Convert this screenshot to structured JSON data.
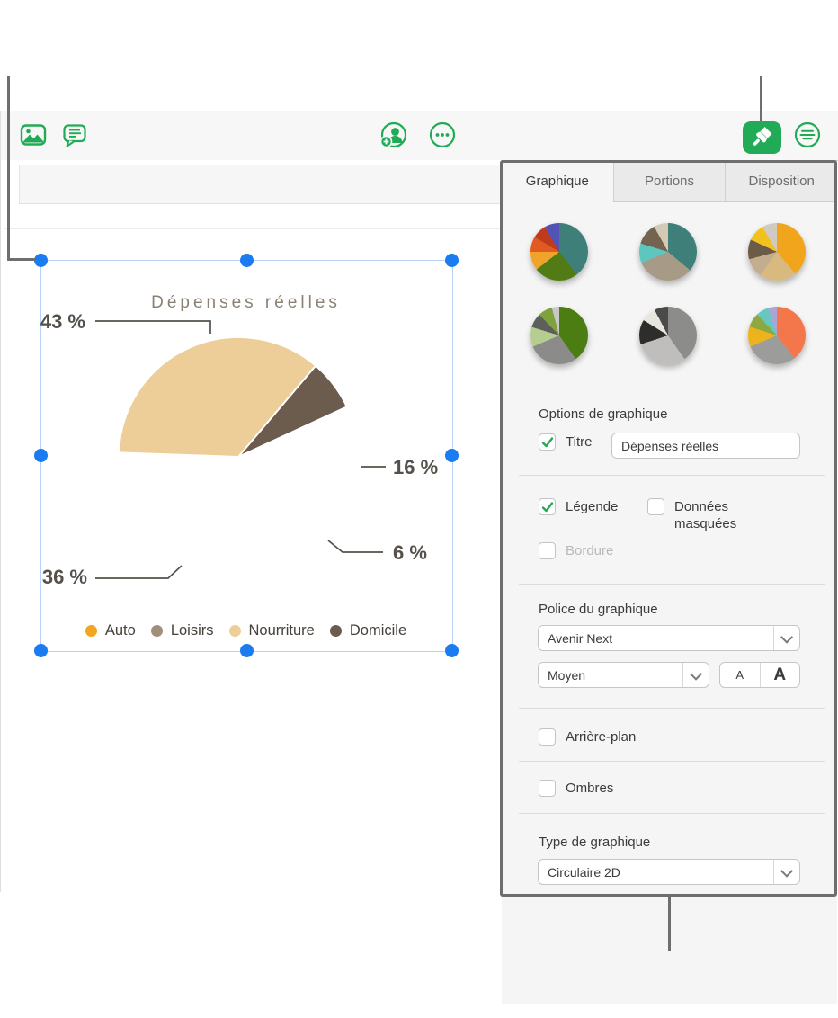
{
  "accent": {
    "green": "#22ab56",
    "selection_blue": "#1b7bf0",
    "callout_gray": "#6e6e6e"
  },
  "toolbar": {
    "icons": [
      "media-icon",
      "comment-icon",
      "add-collaborator-icon",
      "more-icon",
      "format-paintbrush-icon",
      "organize-icon"
    ]
  },
  "sidebar": {
    "tabs": [
      {
        "label": "Graphique",
        "active": true
      },
      {
        "label": "Portions",
        "active": false
      },
      {
        "label": "Disposition",
        "active": false
      }
    ],
    "style_thumbnails": [
      [
        [
          "#3E7F79",
          142
        ],
        [
          "#507B15",
          232
        ],
        [
          "#F0A32A",
          270
        ],
        [
          "#E05A21",
          301
        ],
        [
          "#C03A1D",
          330
        ],
        [
          "#5352B5",
          360
        ]
      ],
      [
        [
          "#3E7F79",
          130
        ],
        [
          "#A79A86",
          247
        ],
        [
          "#5EC6BE",
          287
        ],
        [
          "#74644F",
          331
        ],
        [
          "#D4C9B5",
          360
        ]
      ],
      [
        [
          "#F0A51D",
          140
        ],
        [
          "#D8BA80",
          215
        ],
        [
          "#C2AD8C",
          255
        ],
        [
          "#6C5B46",
          295
        ],
        [
          "#F2C11E",
          330
        ],
        [
          "#CFCAC2",
          360
        ]
      ],
      [
        [
          "#4C7D12",
          145
        ],
        [
          "#8B8B89",
          247
        ],
        [
          "#B5CD8F",
          287
        ],
        [
          "#5E5F5D",
          316
        ],
        [
          "#7FA33C",
          345
        ],
        [
          "#C8C8C6",
          360
        ]
      ],
      [
        [
          "#8C8C8A",
          145
        ],
        [
          "#BFBEBC",
          252
        ],
        [
          "#2D2D2C",
          302
        ],
        [
          "#E9E6E0",
          332
        ],
        [
          "#4B4B4A",
          360
        ]
      ],
      [
        [
          "#F4774B",
          142
        ],
        [
          "#9C9C9A",
          247
        ],
        [
          "#EDB31D",
          288
        ],
        [
          "#8BA93F",
          317
        ],
        [
          "#69C7C1",
          342
        ],
        [
          "#ABA5D5",
          360
        ]
      ]
    ],
    "options": {
      "heading": "Options de graphique",
      "title_label": "Titre",
      "title_checked": true,
      "title_value": "Dépenses réelles",
      "legend_label": "Légende",
      "legend_checked": true,
      "hidden_data_label_line1": "Données",
      "hidden_data_label_line2": "masquées",
      "hidden_data_checked": false,
      "border_label": "Bordure",
      "border_checked": false
    },
    "font": {
      "heading": "Police du graphique",
      "family": "Avenir Next",
      "weight": "Moyen",
      "decrease_label": "A",
      "increase_label": "A"
    },
    "background_label": "Arrière-plan",
    "background_checked": false,
    "shadows_label": "Ombres",
    "shadows_checked": false,
    "type": {
      "heading": "Type de graphique",
      "value": "Circulaire 2D"
    }
  },
  "chart_data": {
    "type": "pie",
    "title": "Dépenses réelles",
    "start_angle_deg": 272,
    "slices": [
      {
        "label": "Domicile",
        "value": 43,
        "display": "43 %",
        "color": "#6B5C4E"
      },
      {
        "label": "Auto",
        "value": 16,
        "display": "16 %",
        "color": "#F2A51F"
      },
      {
        "label": "Loisirs",
        "value": 6,
        "display": "6 %",
        "color": "#A28E79"
      },
      {
        "label": "Nourriture",
        "value": 36,
        "display": "36 %",
        "color": "#EDCD98"
      }
    ],
    "legend": [
      {
        "label": "Auto",
        "color": "#F2A51F"
      },
      {
        "label": "Loisirs",
        "color": "#A28E79"
      },
      {
        "label": "Nourriture",
        "color": "#EDCD98"
      },
      {
        "label": "Domicile",
        "color": "#6B5C4E"
      }
    ],
    "legend_position": "bottom"
  }
}
